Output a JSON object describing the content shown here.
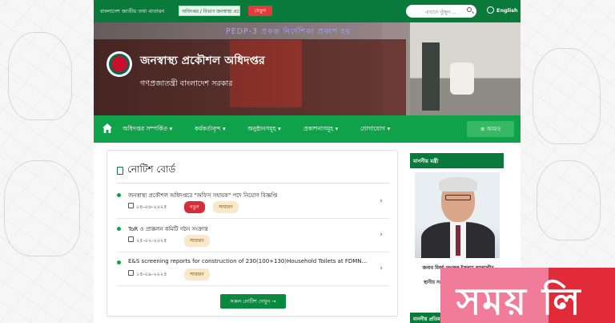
{
  "topbar": {
    "portal_label": "বাংলাদেশ জাতীয় তথ্য বাতায়ন",
    "office_select": "অধিদপ্তর / বিভাগ জনস্বাস্থ্য প্রকৌ",
    "go_button": "যেতুন",
    "search_placeholder": "এখানে খুঁজুন ...",
    "language": "English"
  },
  "banner": {
    "scroll_text": "PEDP-3 প্রকল্প নির্দেশিকা প্রকাশ হয়",
    "site_title": "জনস্বাস্থ্য প্রকৌশল অধিদপ্তর",
    "site_subtitle": "গণপ্রজাতন্ত্রী বাংলাদেশ সরকার"
  },
  "nav": {
    "items": [
      "অধিদপ্তর সম্পর্কিত ▾",
      "কর্মকর্তাবৃন্দ ▾",
      "অনুষ্ঠানসমূহ ▾",
      "প্রকাশনাসমূহ ▾",
      "যোগাযোগ ▾"
    ],
    "more_button": "≡ আরও"
  },
  "notice": {
    "title": "নোটিশ বোর্ড",
    "items": [
      {
        "text": "জনস্বাস্থ্য প্রকৌশল অধিদপ্তরে \"অফিস সহায়ক\" পদে নিয়োগ বিজ্ঞপ্তি",
        "date": "০৪-০৬-২০২৫",
        "badges": [
          "নতুন",
          "সাধারণ"
        ]
      },
      {
        "text": "ToR ও প্রাক্কলন কমিটি গঠন সংক্রান্ত",
        "date": "২৫-০২-২০২৫",
        "badges": [
          "সাধারণ"
        ]
      },
      {
        "text": "E&S screening reports for construction of 230(100+130)Household Toilets at FDMN...",
        "date": "১৫-০৯-২০২৫",
        "badges": [
          "সাধারণ"
        ]
      }
    ],
    "all_button": "সকল নোটিশ দেখুন →"
  },
  "minister": {
    "heading": "মাননীয় মন্ত্রী",
    "name": "জনাব মির্জা ফখরুল ইসলাম আলমগীর",
    "role": "মাননীয় মন্ত্রী",
    "dept": "স্থানীয় সরকার, পল্লী উন্নয়ন ও সমবায়",
    "heading2": "মাননীয় প্রতিমন্ত্রী"
  },
  "watermark": {
    "text": "সময় লি"
  },
  "colors": {
    "green_dark": "#0a7a3a",
    "green_nav": "#10a14b",
    "badge_new": "#d62d3b",
    "badge_general": "#fbe8c8"
  }
}
